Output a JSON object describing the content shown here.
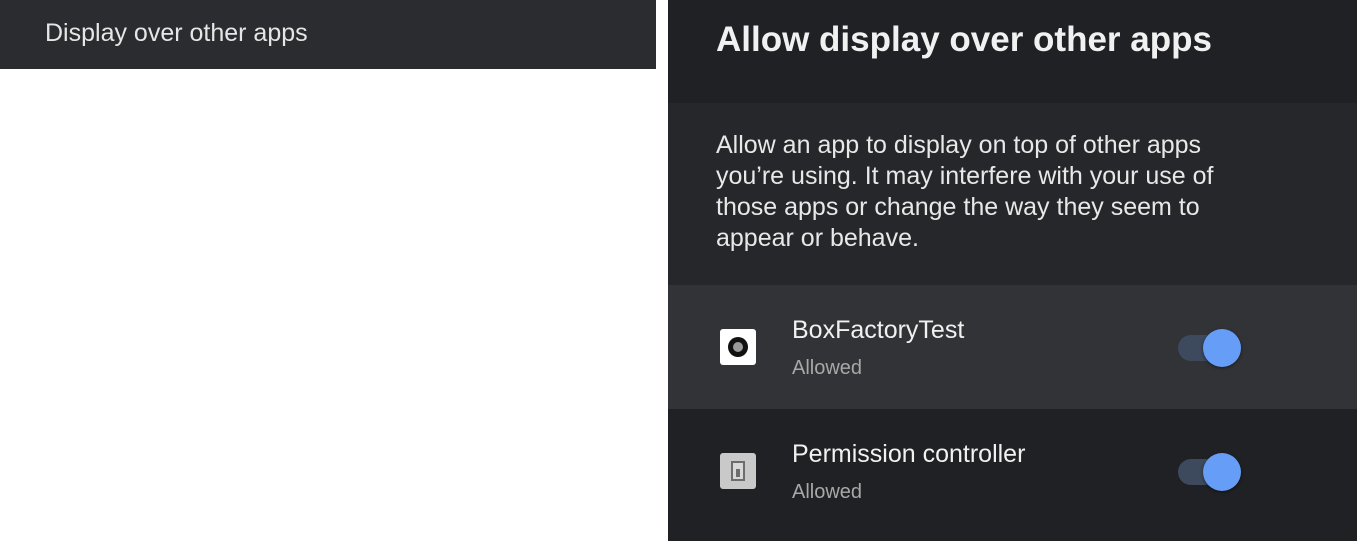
{
  "left_panel": {
    "menu_item_label": "Display over other apps"
  },
  "right_panel": {
    "title": "Allow display over other apps",
    "description": "Allow an app to display on top of other apps you’re using. It may interfere with your use of those apps or change the way they seem to appear or behave.",
    "apps": [
      {
        "name": "BoxFactoryTest",
        "status": "Allowed",
        "icon": "box-factory-app-icon",
        "toggle_on": true
      },
      {
        "name": "Permission controller",
        "status": "Allowed",
        "icon": "permission-controller-app-icon",
        "toggle_on": true
      }
    ]
  },
  "colors": {
    "background_dark": "#202124",
    "row_highlight": "#323336",
    "toggle_thumb": "#669df6",
    "toggle_track": "#3d4a5e",
    "left_bar": "#2b2c2f"
  }
}
